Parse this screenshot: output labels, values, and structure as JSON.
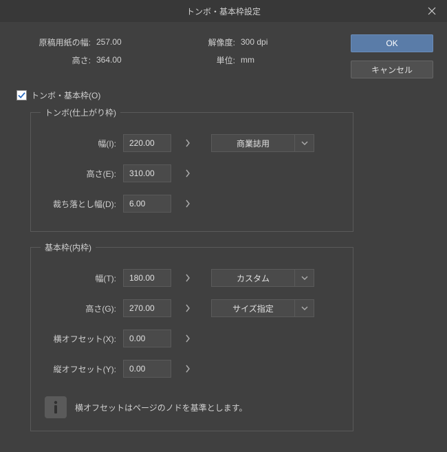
{
  "titlebar": {
    "title": "トンボ・基本枠設定"
  },
  "buttons": {
    "ok": "OK",
    "cancel": "キャンセル"
  },
  "info": {
    "paper_width_label": "原稿用紙の幅:",
    "paper_width": "257.00",
    "height_label": "高さ:",
    "height": "364.00",
    "resolution_label": "解像度:",
    "resolution": "300 dpi",
    "unit_label": "単位:",
    "unit": "mm"
  },
  "checkbox": {
    "label": "トンボ・基本枠(O)",
    "checked": true
  },
  "tombo": {
    "legend": "トンボ(仕上がり枠)",
    "width_label": "幅(I):",
    "width": "220.00",
    "height_label": "高さ(E):",
    "height": "310.00",
    "bleed_label": "裁ち落とし幅(D):",
    "bleed": "6.00",
    "preset": "商業誌用"
  },
  "basic": {
    "legend": "基本枠(内枠)",
    "width_label": "幅(T):",
    "width": "180.00",
    "height_label": "高さ(G):",
    "height": "270.00",
    "hoffset_label": "横オフセット(X):",
    "hoffset": "0.00",
    "voffset_label": "縦オフセット(Y):",
    "voffset": "0.00",
    "preset": "カスタム",
    "size_mode": "サイズ指定",
    "info_text": "横オフセットはページのノドを基準とします。"
  }
}
